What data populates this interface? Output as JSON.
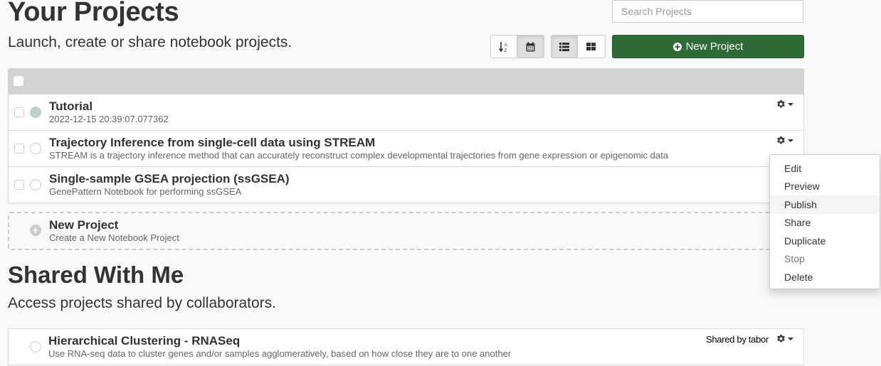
{
  "header": {
    "title": "Your Projects",
    "subtitle": "Launch, create or share notebook projects.",
    "search_placeholder": "Search Projects",
    "sort_buttons": [
      {
        "icon": "sort-alpha-icon",
        "glyph": "↓ᴬᶻ",
        "active": false
      },
      {
        "icon": "calendar-icon",
        "glyph": "📅",
        "active": true
      }
    ],
    "view_buttons": [
      {
        "icon": "list-view-icon",
        "active": true
      },
      {
        "icon": "grid-view-icon",
        "active": false
      }
    ],
    "new_project_label": "New Project"
  },
  "projects": [
    {
      "title": "Tutorial",
      "description": "2022-12-15 20:39:07.077362",
      "status": "running"
    },
    {
      "title": "Trajectory Inference from single-cell data using STREAM",
      "description": "STREAM is a trajectory inference method that can accurately reconstruct complex developmental trajectories from gene expression or epigenomic data",
      "status": "stopped"
    },
    {
      "title": "Single-sample GSEA projection (ssGSEA)",
      "description": "GenePattern Notebook for performing ssGSEA",
      "status": "stopped"
    }
  ],
  "new_project_card": {
    "title": "New Project",
    "description": "Create a New Notebook Project"
  },
  "shared": {
    "title": "Shared With Me",
    "subtitle": "Access projects shared by collaborators.",
    "projects": [
      {
        "title": "Hierarchical Clustering - RNASeq",
        "description": "Use RNA-seq data to cluster genes and/or samples agglomeratively, based on how close they are to one another",
        "shared_by": "Shared by tabor"
      }
    ]
  },
  "context_menu": {
    "items": [
      {
        "label": "Edit",
        "state": "normal"
      },
      {
        "label": "Preview",
        "state": "normal"
      },
      {
        "label": "Publish",
        "state": "hover"
      },
      {
        "label": "Share",
        "state": "normal"
      },
      {
        "label": "Duplicate",
        "state": "normal"
      },
      {
        "label": "Stop",
        "state": "disabled"
      },
      {
        "label": "Delete",
        "state": "normal"
      }
    ]
  }
}
